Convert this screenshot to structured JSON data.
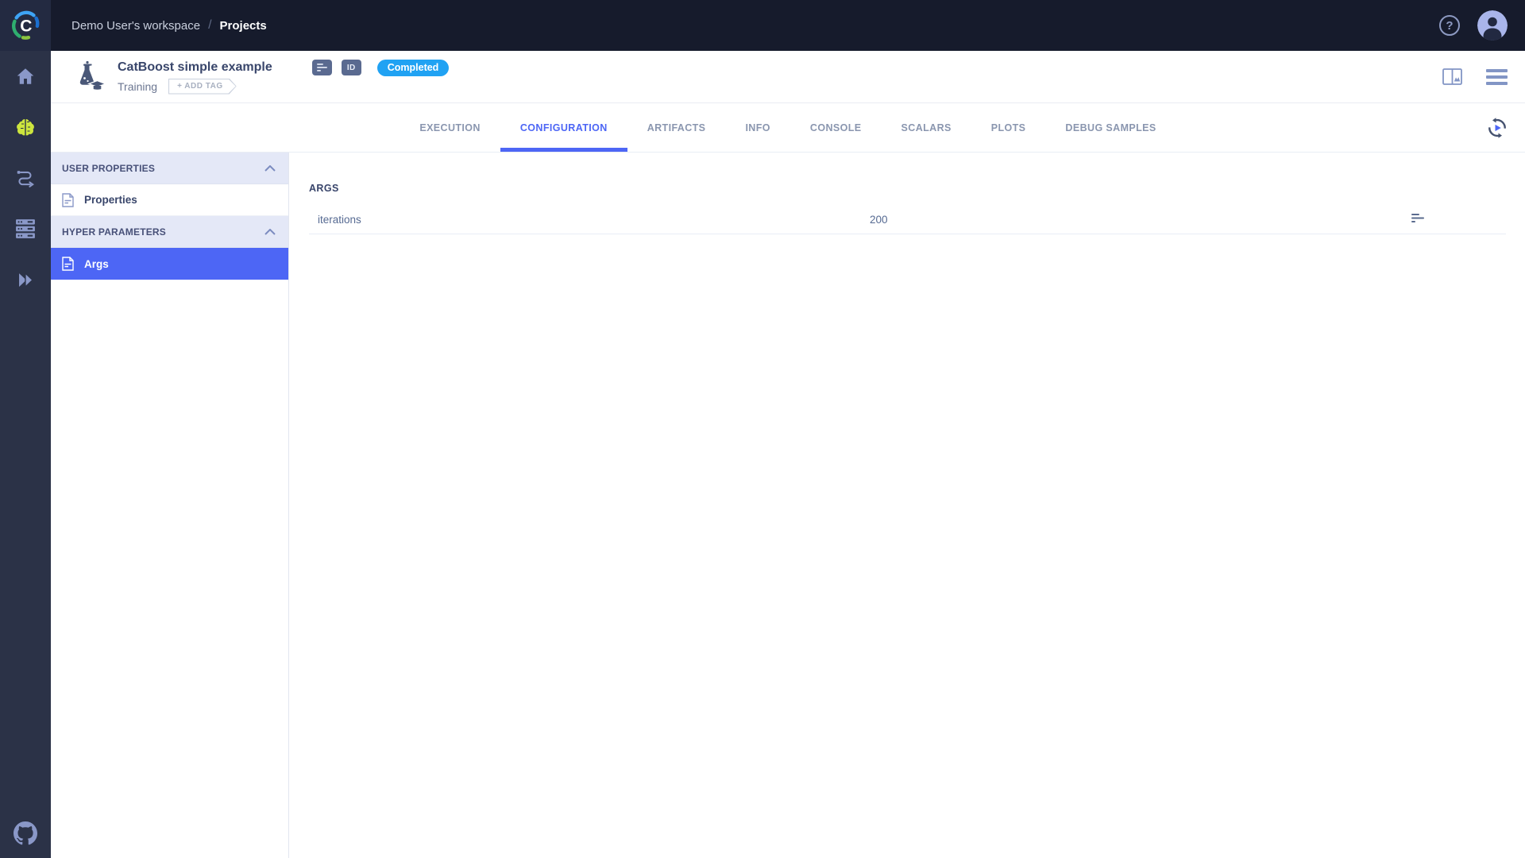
{
  "topbar": {
    "breadcrumb": {
      "workspace": "Demo User's workspace",
      "separator": "/",
      "current": "Projects"
    },
    "help_glyph": "?"
  },
  "sidebar": {
    "items": [
      {
        "name": "dashboard",
        "icon": "home-icon"
      },
      {
        "name": "projects",
        "icon": "brain-icon"
      },
      {
        "name": "pipelines",
        "icon": "pipelines-icon"
      },
      {
        "name": "datasets",
        "icon": "datasets-icon"
      },
      {
        "name": "applications",
        "icon": "double-chevron-icon"
      }
    ],
    "footer": {
      "name": "github",
      "icon": "github-icon"
    }
  },
  "experiment": {
    "title": "CatBoost simple example",
    "type": "Training",
    "add_tag_label": "+ ADD TAG",
    "id_badge_label": "ID",
    "status": "Completed"
  },
  "tabs": [
    {
      "label": "EXECUTION",
      "active": false
    },
    {
      "label": "CONFIGURATION",
      "active": true
    },
    {
      "label": "ARTIFACTS",
      "active": false
    },
    {
      "label": "INFO",
      "active": false
    },
    {
      "label": "CONSOLE",
      "active": false
    },
    {
      "label": "SCALARS",
      "active": false
    },
    {
      "label": "PLOTS",
      "active": false
    },
    {
      "label": "DEBUG SAMPLES",
      "active": false
    }
  ],
  "panel": {
    "sections": [
      {
        "title": "USER PROPERTIES",
        "items": [
          {
            "label": "Properties",
            "selected": false
          }
        ]
      },
      {
        "title": "HYPER PARAMETERS",
        "items": [
          {
            "label": "Args",
            "selected": true
          }
        ]
      }
    ]
  },
  "content": {
    "section_title": "ARGS",
    "parameters": [
      {
        "name": "iterations",
        "value": "200"
      }
    ]
  },
  "colors": {
    "accent_blue": "#4d66f5",
    "status_blue": "#20a2f3",
    "topbar_bg": "#161b2c",
    "sidebar_bg": "#2b3247",
    "lime": "#cde53e",
    "slate_icon": "#5a6a90"
  }
}
